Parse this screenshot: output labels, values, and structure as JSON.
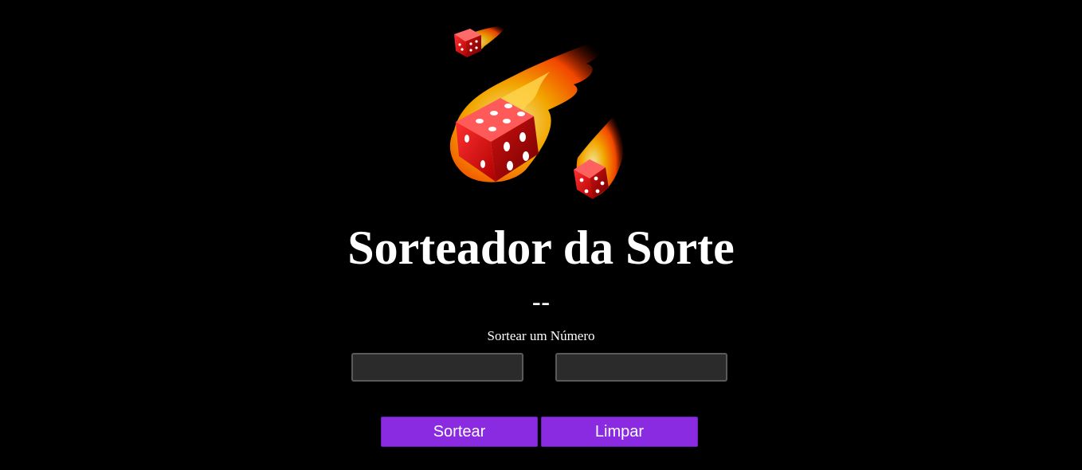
{
  "header": {
    "title": "Sorteador da Sorte"
  },
  "result": {
    "value": "--"
  },
  "form": {
    "label": "Sortear um Número",
    "min_value": "",
    "max_value": ""
  },
  "actions": {
    "draw_label": "Sortear",
    "clear_label": "Limpar"
  },
  "theme": {
    "background": "#000000",
    "accent": "#8a2be2",
    "field_bg": "#2b2b2b",
    "text": "#ffffff"
  },
  "hero": {
    "icon": "flaming-dice-icon"
  }
}
